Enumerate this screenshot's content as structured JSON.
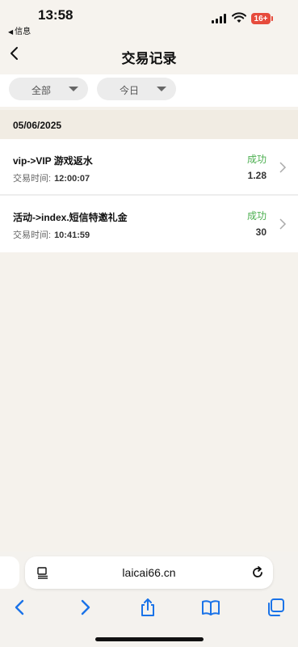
{
  "status_bar": {
    "time": "13:58",
    "back_app": "信息",
    "battery": "16+"
  },
  "nav": {
    "title": "交易记录"
  },
  "filters": [
    {
      "label": "全部"
    },
    {
      "label": "今日"
    }
  ],
  "date_header": "05/06/2025",
  "records": [
    {
      "title": "vip->VIP 游戏返水",
      "time_label": "交易时间:",
      "time": "12:00:07",
      "status": "成功",
      "amount": "1.28"
    },
    {
      "title": "活动->index.短信特邀礼金",
      "time_label": "交易时间:",
      "time": "10:41:59",
      "status": "成功",
      "amount": "30"
    }
  ],
  "browser": {
    "url": "laicai66.cn"
  },
  "colors": {
    "success": "#4caf50",
    "background": "#f5f2ec",
    "accent_link": "#1a73e8"
  }
}
